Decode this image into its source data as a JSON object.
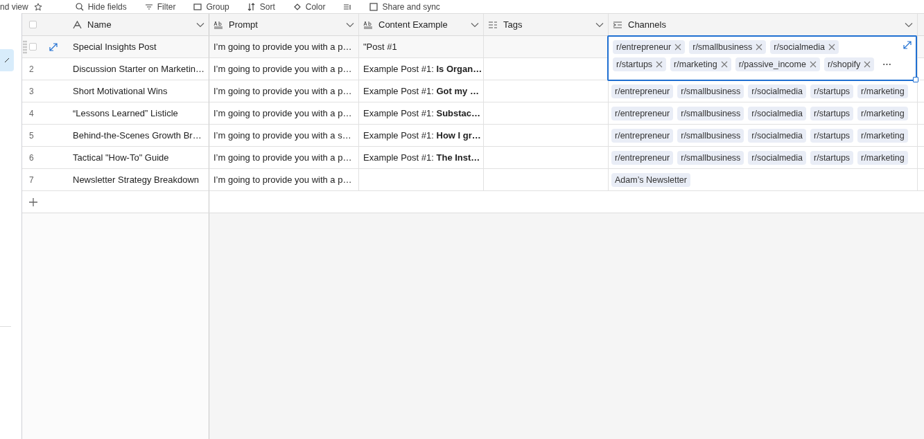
{
  "toolbar": {
    "view_name": "nd view",
    "items": [
      {
        "kind": "hide",
        "label": "Hide fields"
      },
      {
        "kind": "filter",
        "label": "Filter"
      },
      {
        "kind": "group",
        "label": "Group"
      },
      {
        "kind": "sort",
        "label": "Sort"
      },
      {
        "kind": "color",
        "label": "Color"
      },
      {
        "kind": "height"
      },
      {
        "kind": "share",
        "label": "Share and sync"
      }
    ]
  },
  "select_all": {
    "checked": false
  },
  "columns": [
    {
      "kind": "primary",
      "name": "Name"
    },
    {
      "kind": "long_text",
      "name": "Prompt"
    },
    {
      "kind": "long_text",
      "name": "Content Example"
    },
    {
      "kind": "multi_select",
      "name": "Tags"
    },
    {
      "kind": "link",
      "name": "Channels"
    }
  ],
  "rows": [
    {
      "hovered": true,
      "checked": false,
      "name": "Special Insights Post",
      "prompt": "I’m going to provide you with a p…",
      "content": "\"Post #1",
      "channel_lines": [
        [
          "r/entrepreneur",
          "r/smallbusiness",
          "r/socialmedia"
        ],
        [
          "r/startups",
          "r/marketing",
          "r/passive_income",
          "r/shopify"
        ]
      ],
      "editing": true,
      "more": "⋯"
    },
    {
      "hovered": false,
      "checked": false,
      "number": "2",
      "name": "Discussion Starter on Marketin…",
      "prompt": "I’m going to provide you with a p…",
      "content": "Example Post #1: **Is Organ…**",
      "channels": [],
      "editing": false
    },
    {
      "hovered": false,
      "checked": false,
      "number": "3",
      "name": "Short Motivational Wins",
      "prompt": "I’m going to provide you with a p…",
      "content": "Example Post #1: **Got my …**",
      "channels": [
        "r/entrepreneur",
        "r/smallbusiness",
        "r/socialmedia",
        "r/startups",
        "r/marketing"
      ],
      "editing": false
    },
    {
      "hovered": false,
      "checked": false,
      "number": "4",
      "name": "“Lessons Learned” Listicle",
      "prompt": "I’m going to provide you with a p…",
      "content": "Example Post #1: **Substac…**",
      "channels": [
        "r/entrepreneur",
        "r/smallbusiness",
        "r/socialmedia",
        "r/startups",
        "r/marketing"
      ],
      "editing": false
    },
    {
      "hovered": false,
      "checked": false,
      "number": "5",
      "name": "Behind-the-Scenes Growth Br…",
      "prompt": "I’m going to provide you with a s…",
      "content": "Example Post #1: **How I gr…**",
      "channels": [
        "r/entrepreneur",
        "r/smallbusiness",
        "r/socialmedia",
        "r/startups",
        "r/marketing"
      ],
      "editing": false
    },
    {
      "hovered": false,
      "checked": false,
      "number": "6",
      "name": "Tactical \"How-To\" Guide",
      "prompt": "I’m going to provide you with a p…",
      "content": "Example Post #1: **The Inst…**",
      "channels": [
        "r/entrepreneur",
        "r/smallbusiness",
        "r/socialmedia",
        "r/startups",
        "r/marketing"
      ],
      "editing": false
    },
    {
      "hovered": false,
      "checked": false,
      "number": "7",
      "name": "Newsletter Strategy Breakdown",
      "prompt": "I’m going to provide you with a p…",
      "content": "",
      "channels": [
        "Adam’s Newsletter"
      ],
      "editing": false
    }
  ]
}
